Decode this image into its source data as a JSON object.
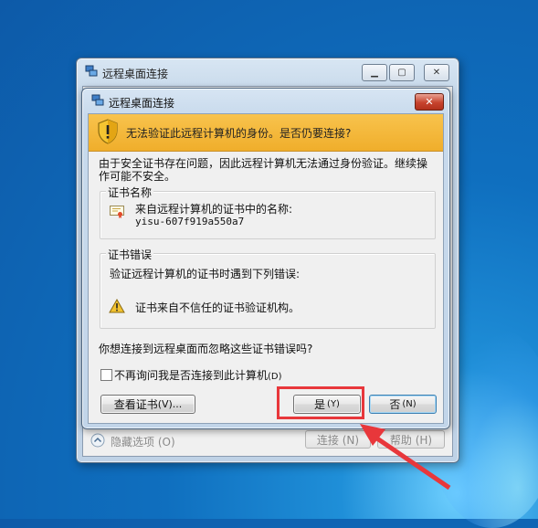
{
  "outer_window": {
    "title": "远程桌面连接",
    "hide_options": "隐藏选项 (O)",
    "connect_button": "连接 (N)",
    "help_button": "帮助 (H)"
  },
  "dialog": {
    "title": "远程桌面连接",
    "close_symbol": "✕",
    "banner": "无法验证此远程计算机的身份。是否仍要连接?",
    "intro": "由于安全证书存在问题，因此远程计算机无法通过身份验证。继续操作可能不安全。",
    "cert_name": {
      "legend": "证书名称",
      "label": "来自远程计算机的证书中的名称:",
      "value": "yisu-607f919a550a7"
    },
    "cert_errors": {
      "legend": "证书错误",
      "heading": "验证远程计算机的证书时遇到下列错误:",
      "item": "证书来自不信任的证书验证机构。"
    },
    "question": "你想连接到远程桌面而忽略这些证书错误吗?",
    "checkbox_label": "不再询问我是否连接到此计算机",
    "checkbox_key": "(D)",
    "view_cert_text": "查看证书",
    "view_cert_key": "(V)...",
    "yes_text": "是",
    "yes_key": "(Y)",
    "no_text": "否",
    "no_key": "(N)"
  },
  "colors": {
    "banner": "#f0ae2b",
    "annotation": "#e8373b"
  }
}
